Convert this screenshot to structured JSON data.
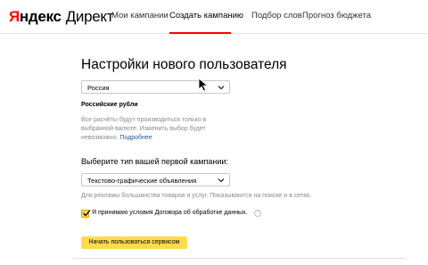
{
  "header": {
    "logo_ya": "Я",
    "logo_ya_rest": "ндекс",
    "logo_direct": "Директ",
    "nav": [
      {
        "label": "Мои кампании",
        "active": false
      },
      {
        "label": "Создать кампанию",
        "active": true
      },
      {
        "label": "Подбор слов",
        "active": false
      },
      {
        "label": "Прогноз бюджета",
        "active": false
      }
    ]
  },
  "main": {
    "title": "Настройки нового пользователя",
    "country_select": {
      "value": "Россия",
      "icon": "chevron-down-icon"
    },
    "currency": "Российские рубли",
    "note": {
      "line1": "Все расчёты будут производиться только в",
      "line2": "выбранной валюте. Изменить выбор будет",
      "line3_text": "невозможно.",
      "link": "Подробнее"
    },
    "campaign_type_label": "Выберите тип вашей первой кампании:",
    "campaign_type_select": {
      "value": "Текстово-графические объявления",
      "icon": "chevron-down-icon"
    },
    "campaign_hint": "Для рекламы большинства товаров и услуг. Показываются на поиске и в сетях.",
    "agreement": {
      "checked": true,
      "text": "Я принимаю условия Договора об обработке данных.",
      "info_icon": "?"
    },
    "submit_label": "Начать пользоваться сервисом"
  },
  "colors": {
    "brand_red": "#ff0000",
    "accent_yellow": "#ffdb4d",
    "link_blue": "#2b5a93",
    "muted_text": "#8a8a8a"
  }
}
